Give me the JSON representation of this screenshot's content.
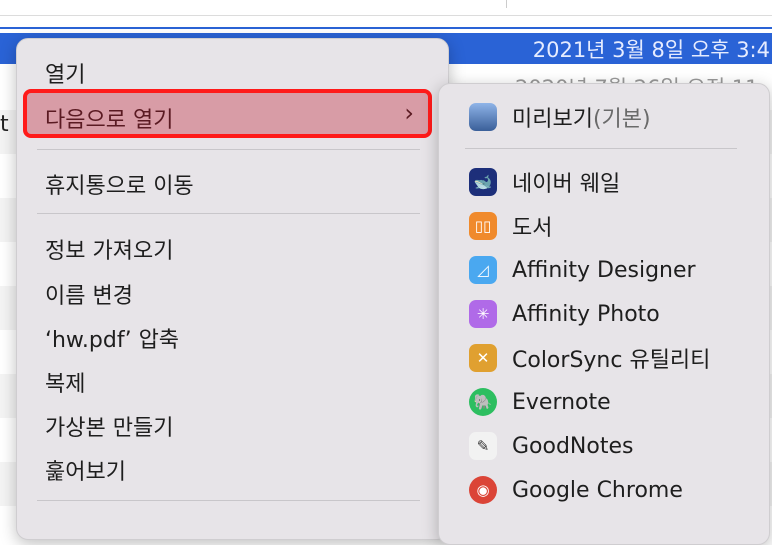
{
  "background": {
    "selected_date": "2021년 3월 8일 오후 3:4",
    "other_date": "2020년 7월 26일 오전 11",
    "edge_char": "t"
  },
  "context_menu": {
    "open": "열기",
    "open_with": "다음으로 열기",
    "move_to_trash": "휴지통으로 이동",
    "get_info": "정보 가져오기",
    "rename": "이름 변경",
    "compress": "‘hw.pdf’ 압축",
    "duplicate": "복제",
    "make_alias": "가상본 만들기",
    "quick_look": "훑어보기"
  },
  "submenu": {
    "default_app": "미리보기",
    "default_suffix": "(기본)",
    "apps": [
      {
        "label": "네이버 웨일",
        "icon": "whale-icon",
        "color": "#1d2f7a"
      },
      {
        "label": "도서",
        "icon": "books-icon",
        "color": "#f08a2c"
      },
      {
        "label": "Affinity Designer",
        "icon": "affinity-designer-icon",
        "color": "#4aa8f0"
      },
      {
        "label": "Affinity Photo",
        "icon": "affinity-photo-icon",
        "color": "#b06ae8"
      },
      {
        "label": "ColorSync 유틸리티",
        "icon": "colorsync-icon",
        "color": "#e0a030"
      },
      {
        "label": "Evernote",
        "icon": "evernote-icon",
        "color": "#2dbe60"
      },
      {
        "label": "GoodNotes",
        "icon": "goodnotes-icon",
        "color": "#f2f2f2"
      },
      {
        "label": "Google Chrome",
        "icon": "chrome-icon",
        "color": "#db4437"
      }
    ]
  }
}
